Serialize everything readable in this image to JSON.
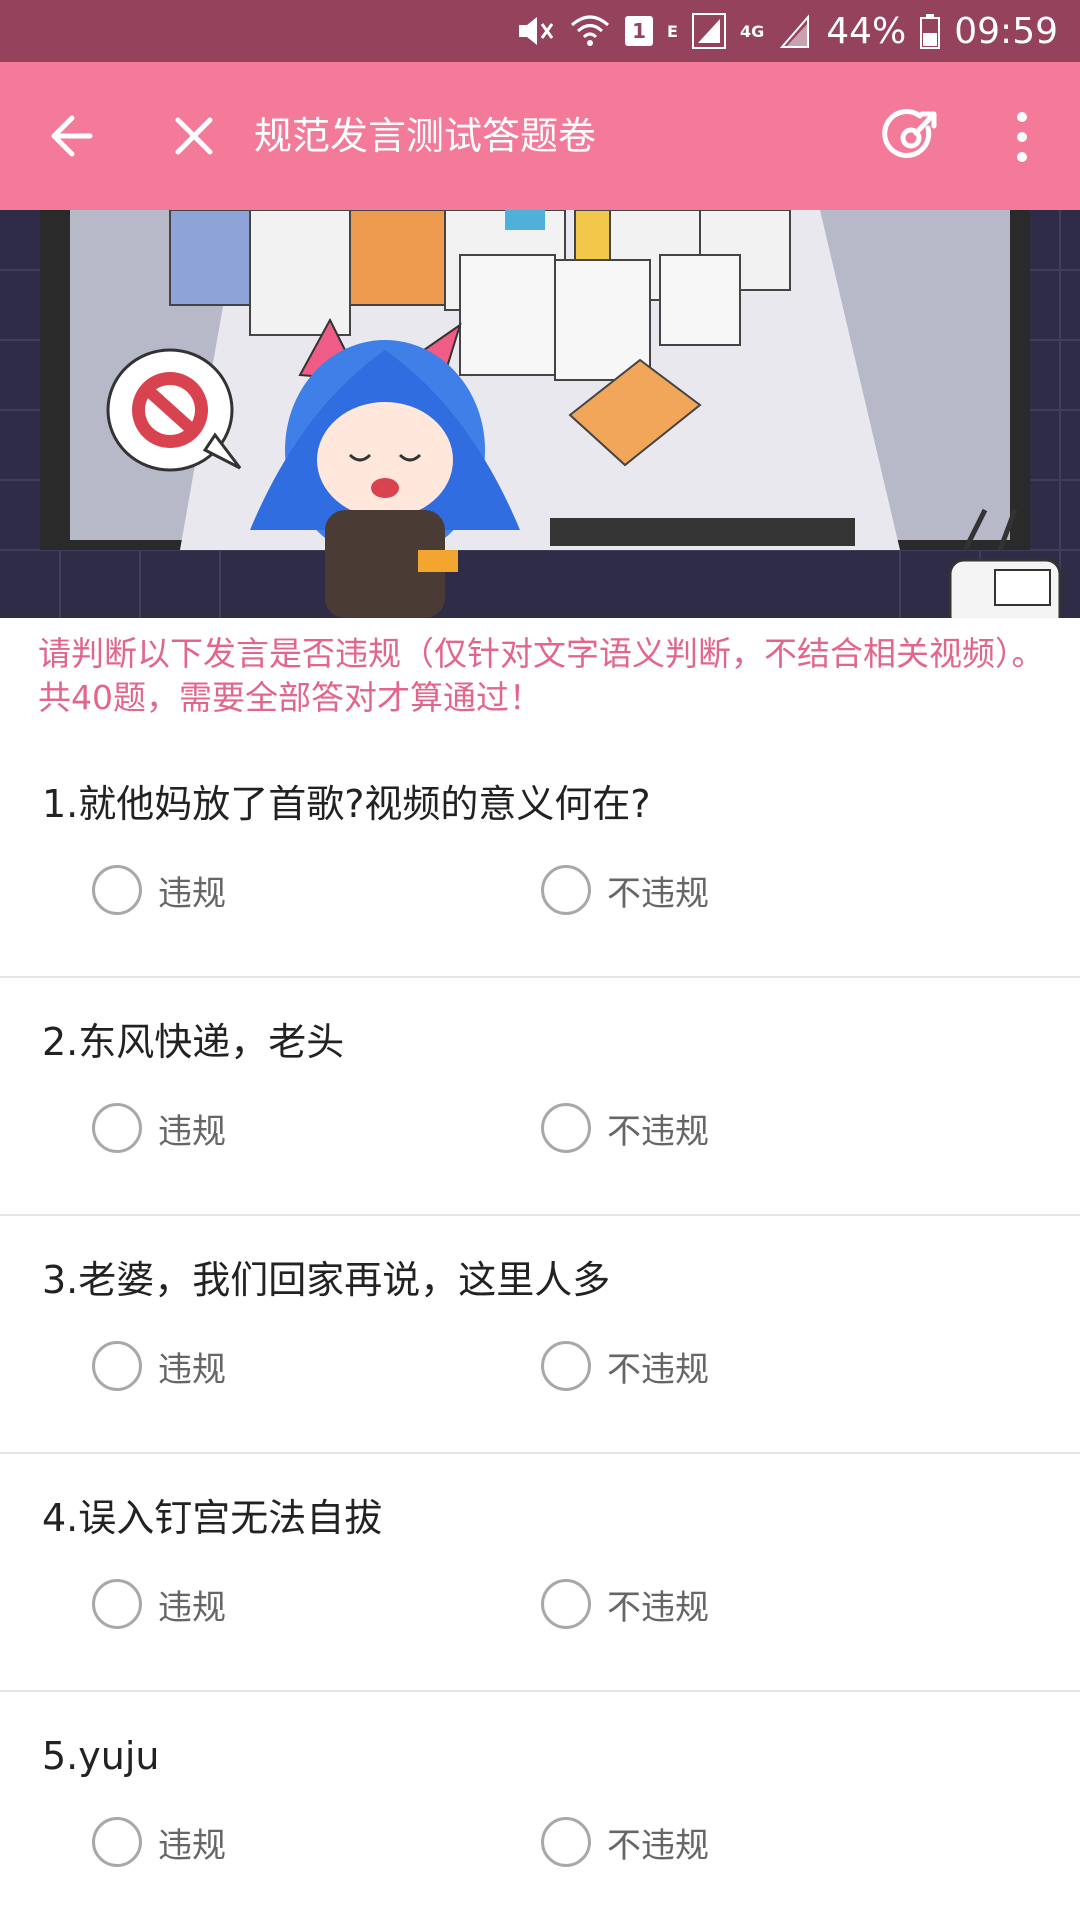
{
  "status_bar": {
    "sim_slot": "1",
    "network_e": "E",
    "network_4g": "4G",
    "battery": "44%",
    "time": "09:59"
  },
  "app_bar": {
    "title": "规范发言测试答题卷"
  },
  "notice": "请判断以下发言是否违规（仅针对文字语义判断，不结合相关视频）。共40题，需要全部答对才算通过！",
  "questions": [
    {
      "text": "1.就他妈放了首歌?视频的意义何在?",
      "opt_a": "违规",
      "opt_b": "不违规"
    },
    {
      "text": "2.东风快递，老头",
      "opt_a": "违规",
      "opt_b": "不违规"
    },
    {
      "text": "3.老婆，我们回家再说，这里人多",
      "opt_a": "违规",
      "opt_b": "不违规"
    },
    {
      "text": "4.误入钉宫无法自拔",
      "opt_a": "违规",
      "opt_b": "不违规"
    },
    {
      "text": "5.yuju",
      "opt_a": "违规",
      "opt_b": "不违规"
    }
  ],
  "colors": {
    "status_bar": "#95425d",
    "app_bar": "#f47a9a",
    "notice_text": "#e2668a"
  }
}
